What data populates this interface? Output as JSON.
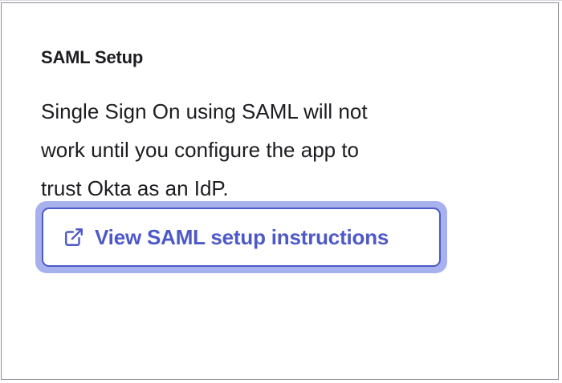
{
  "card": {
    "title": "SAML Setup",
    "description_lines": [
      "Single Sign On using SAML will not",
      "work until you configure the app to",
      "trust Okta as an IdP."
    ],
    "button": {
      "label": "View SAML setup instructions",
      "icon": "external-link-icon"
    }
  },
  "colors": {
    "accent": "#4d59c7",
    "focus_ring": "#a7b1ee",
    "text": "#1d1d21"
  }
}
